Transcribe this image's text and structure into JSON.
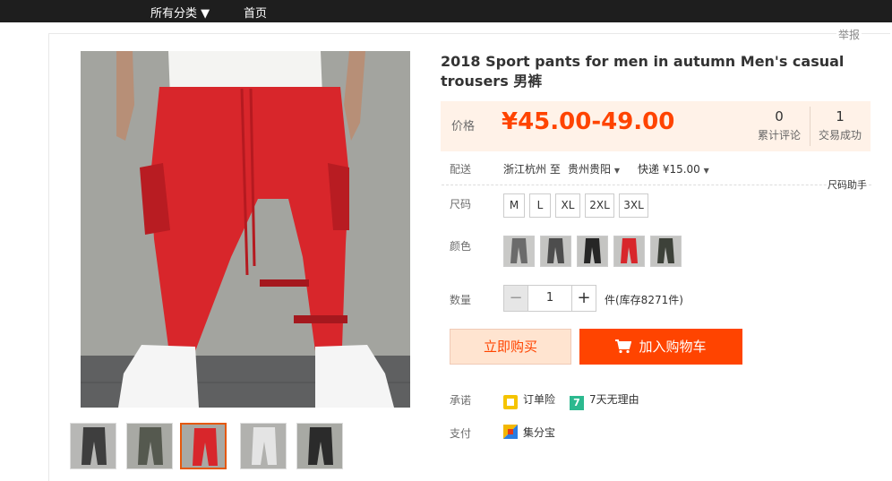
{
  "topbar": {
    "categories": "所有分类 ▼",
    "home": "首页"
  },
  "report": "举报",
  "product": {
    "title": "2018 Sport pants for men in autumn Men's casual trousers 男裤"
  },
  "price": {
    "label": "价格",
    "value": "¥45.00-49.00",
    "reviews_count": "0",
    "reviews_label": "累计评论",
    "deals_count": "1",
    "deals_label": "交易成功"
  },
  "shipping": {
    "label": "配送",
    "from": "浙江杭州 至",
    "to": "贵州贵阳",
    "method": "快递 ¥15.00",
    "size_helper": "尺码助手"
  },
  "size": {
    "label": "尺码",
    "options": [
      "M",
      "L",
      "XL",
      "2XL",
      "3XL"
    ]
  },
  "color": {
    "label": "颜色"
  },
  "quantity": {
    "label": "数量",
    "value": "1",
    "minus": "−",
    "plus": "+",
    "stock": "件(库存8271件)"
  },
  "actions": {
    "buy_now": "立即购买",
    "add_cart": "加入购物车"
  },
  "promise": {
    "label": "承诺",
    "items": [
      "订单险",
      "7天无理由"
    ],
    "badge7": "7"
  },
  "payment": {
    "label": "支付",
    "method": "集分宝"
  },
  "colors": {
    "accent": "#ff4400",
    "price_bg": "#fff2e8",
    "pants_red": "#d8262b"
  }
}
